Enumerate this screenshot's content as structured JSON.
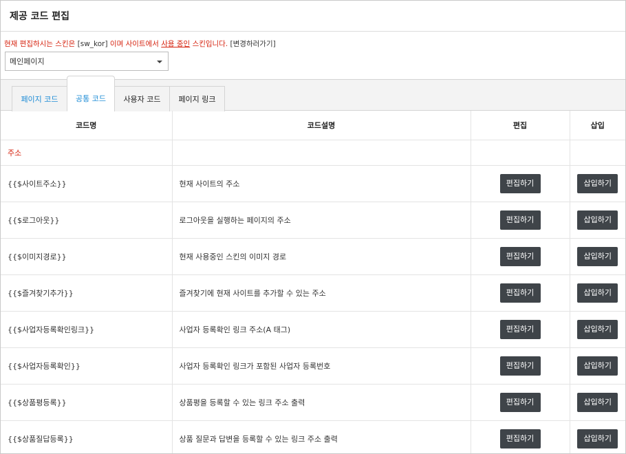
{
  "title": "제공 코드 편집",
  "notice": {
    "prefix": "현재 편집하시는 스킨은",
    "skin": "[sw_kor]",
    "middle": "이며 사이트에서",
    "in_use": "사용 중인",
    "suffix": "스킨입니다.",
    "change_link": "[변경하러가기]"
  },
  "page_select": {
    "value": "메인페이지"
  },
  "tabs": [
    {
      "label": "페이지 코드"
    },
    {
      "label": "공통 코드"
    },
    {
      "label": "사용자 코드"
    },
    {
      "label": "페이지 링크"
    }
  ],
  "table": {
    "headers": [
      "코드명",
      "코드설명",
      "편집",
      "삽입"
    ],
    "group": "주소",
    "rows": [
      {
        "code": "{{$사이트주소}}",
        "desc": "현재 사이트의 주소"
      },
      {
        "code": "{{$로그아웃}}",
        "desc": "로그아웃을 실행하는 페이지의 주소"
      },
      {
        "code": "{{$이미지경로}}",
        "desc": "현재 사용중인 스킨의 이미지 경로"
      },
      {
        "code": "{{$즐겨찾기추가}}",
        "desc": "즐겨찾기에 현재 사이트를 추가할 수 있는 주소"
      },
      {
        "code": "{{$사업자등록확인링크}}",
        "desc": "사업자 등록확인 링크 주소(A 태그)"
      },
      {
        "code": "{{$사업자등록확인}}",
        "desc": "사업자 등록확인 링크가 포함된 사업자 등록번호"
      },
      {
        "code": "{{$상품평등록}}",
        "desc": "상품평을 등록할 수 있는 링크 주소 출력"
      },
      {
        "code": "{{$상품질답등록}}",
        "desc": "상품 질문과 답변을 등록할 수 있는 링크 주소 출력"
      }
    ],
    "edit_label": "편집하기",
    "insert_label": "삽입하기"
  },
  "colors": {
    "accent_red": "#d6230f",
    "tab_blue": "#1f8dd6",
    "button_bg": "#3f4449"
  }
}
